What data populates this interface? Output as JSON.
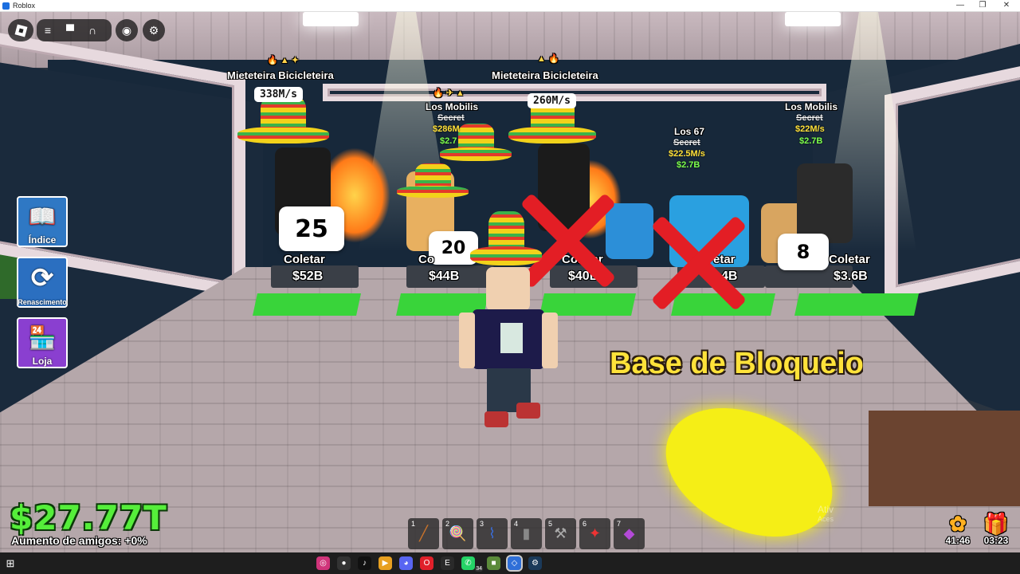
{
  "window": {
    "title": "Roblox",
    "minimize": "—",
    "maximize": "❐",
    "close": "✕"
  },
  "topbar": {
    "menu_icon": "≡",
    "chat_icon": "▀",
    "headphones_icon": "∩",
    "backpack_icon": "◉",
    "settings_icon": "⚙"
  },
  "side_menu": [
    {
      "label": "Índice",
      "icon": "📖",
      "color": "#2f78c4"
    },
    {
      "label": "Renascimento",
      "icon": "⟳",
      "color": "#2b6fc0"
    },
    {
      "label": "Loja",
      "icon": "🏪",
      "color": "#8a3fd0"
    }
  ],
  "brainrots": [
    {
      "name": "Mieteteira Bicicleteira",
      "speed": "338M/s",
      "icons": "🔥 ▲ ✦"
    },
    {
      "name": "Los Mobilis",
      "secret": "Secret",
      "rate": "$286M",
      "value": "$2.7",
      "icons": "🔥 ✈ ▲"
    },
    {
      "name": "Mieteteira Bicicleteira",
      "speed": "260M/s",
      "icons": "▲ 🔥"
    },
    {
      "name": "Los 67",
      "secret": "Secret",
      "rate": "$22.5M/s",
      "value": "$2.7B"
    },
    {
      "name": "Los Mobilis",
      "secret": "Secret",
      "rate": "$22M/s",
      "value": "$2.7B"
    }
  ],
  "pedestals": [
    {
      "timer": "25",
      "collect": "Coletar",
      "price": "$52B"
    },
    {
      "timer": "20",
      "collect": "Co",
      "price": "$44B"
    },
    {
      "collect": "Coletar",
      "price": "$40B"
    },
    {
      "collect": "etar",
      "price": "4B"
    },
    {
      "timer": "8",
      "collect": "Coletar",
      "price": "$3.6B"
    }
  ],
  "base_sign": "Base de Bloqueio",
  "money": "$27.77T",
  "friends_boost": "Aumento de amigos: +0%",
  "hotbar": [
    {
      "num": "1",
      "tool": "╱",
      "color": "#c9732b"
    },
    {
      "num": "2",
      "tool": "🍭",
      "color": "#e44"
    },
    {
      "num": "3",
      "tool": "⌇",
      "color": "#3a6cd8"
    },
    {
      "num": "4",
      "tool": "▮",
      "color": "#555"
    },
    {
      "num": "5",
      "tool": "⚒",
      "color": "#888"
    },
    {
      "num": "6",
      "tool": "✦",
      "color": "#e33"
    },
    {
      "num": "7",
      "tool": "◆",
      "color": "#b44ad8"
    }
  ],
  "rewards": [
    {
      "icon": "✿",
      "time": "41:46",
      "color": "#ffb020"
    },
    {
      "icon": "🎁",
      "time": "03:23",
      "color": "#3ad0c8"
    }
  ],
  "watermark": {
    "line1": "Ativ",
    "line2": "Aces"
  },
  "taskbar": {
    "start_icon": "⊞",
    "apps": [
      {
        "name": "instagram",
        "color": "#d0347a",
        "glyph": "◎"
      },
      {
        "name": "obs",
        "color": "#333",
        "glyph": "●"
      },
      {
        "name": "tiktok",
        "color": "#111",
        "glyph": "♪"
      },
      {
        "name": "kite",
        "color": "#e8a020",
        "glyph": "▶"
      },
      {
        "name": "discord",
        "color": "#5865f2",
        "glyph": "◕"
      },
      {
        "name": "opera",
        "color": "#e0202a",
        "glyph": "O"
      },
      {
        "name": "epic",
        "color": "#2a2a2a",
        "glyph": "E"
      },
      {
        "name": "whatsapp",
        "color": "#25d366",
        "glyph": "✆"
      },
      {
        "name": "minecraft",
        "color": "#5b8a3a",
        "glyph": "■"
      },
      {
        "name": "roblox",
        "color": "#2f6fd8",
        "glyph": "◇"
      },
      {
        "name": "steam",
        "color": "#1b3a5a",
        "glyph": "⚙"
      }
    ],
    "badge": "34"
  }
}
